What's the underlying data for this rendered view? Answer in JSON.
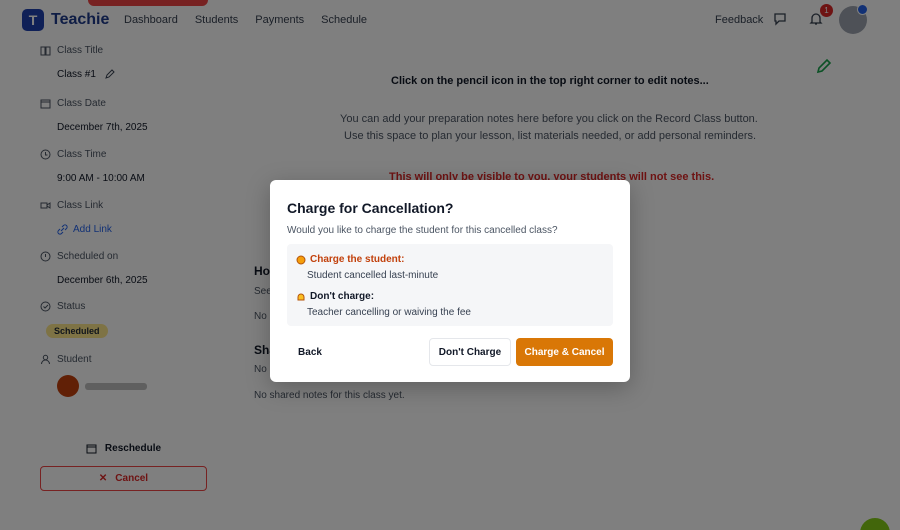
{
  "app": {
    "logo_letter": "T",
    "brand": "Teachie"
  },
  "nav": {
    "links": [
      "Dashboard",
      "Students",
      "Payments",
      "Schedule"
    ],
    "feedback": "Feedback",
    "notification_count": "1"
  },
  "sidebar": {
    "class_title_label": "Class Title",
    "class_title_value": "Class #1",
    "class_date_label": "Class Date",
    "class_date_value": "December 7th, 2025",
    "class_time_label": "Class Time",
    "class_time_value": "9:00 AM - 10:00 AM",
    "class_link_label": "Class Link",
    "class_link_value": "Add Link",
    "scheduled_label": "Scheduled on",
    "scheduled_value": "December 6th, 2025",
    "status_label": "Status",
    "status_value": "Scheduled",
    "student_label": "Student",
    "reschedule": "Reschedule",
    "cancel": "Cancel"
  },
  "main": {
    "notes_title": "Click on the pencil icon in the top right corner to edit notes...",
    "notes_line1": "You can add your preparation notes here before you click on the Record Class button.",
    "notes_line2": "Use this space to plan your lesson, list materials needed, or add personal reminders.",
    "notes_warning": "This will only be visible to you, your students will not see this.",
    "section1_head": "Ho",
    "section1_sub": "See",
    "section1_empty": "No",
    "section2_head": "Sha",
    "section2_sub": "No",
    "shared_empty": "No shared notes for this class yet."
  },
  "modal": {
    "title": "Charge for Cancellation?",
    "description": "Would you like to charge the student for this cancelled class?",
    "option_charge_title": "Charge the student:",
    "option_charge_sub": "Student cancelled last-minute",
    "option_nocharge_title": "Don't charge:",
    "option_nocharge_sub": "Teacher cancelling or waiving the fee",
    "back": "Back",
    "dont_charge": "Don't Charge",
    "charge_cancel": "Charge & Cancel"
  },
  "colors": {
    "accent": "#d97706",
    "brand": "#1e3a8a",
    "danger": "#dc2626",
    "charge_text": "#c2410c"
  }
}
